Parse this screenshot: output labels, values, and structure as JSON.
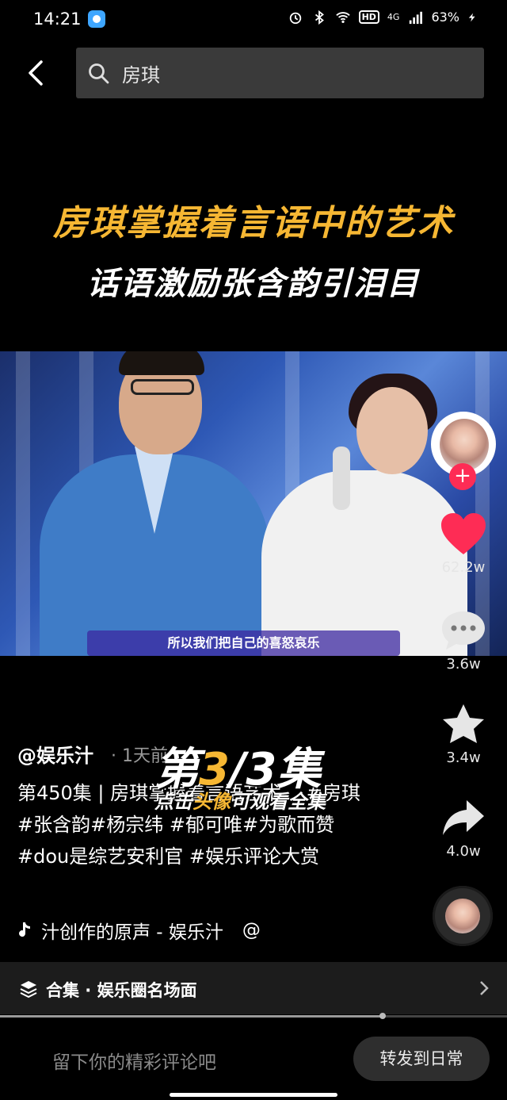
{
  "status_bar": {
    "time": "14:21",
    "battery": "63%",
    "net": "4G",
    "hd": "HD"
  },
  "search": {
    "query": "房琪"
  },
  "video": {
    "headline1": "房琪掌握着言语中的艺术",
    "headline2": "话语激励张含韵引泪目",
    "subtitle": "所以我们把自己的喜怒哀乐"
  },
  "actions": {
    "likes": "62.2w",
    "comments": "3.6w",
    "favorites": "3.4w",
    "shares": "4.0w"
  },
  "post": {
    "author": "@娱乐汁",
    "age": "· 1天前",
    "description": "第450集 | 房琪掌握着言语艺术， #房琪#张含韵#杨宗纬 #郁可唯#为歌而赞 #dou是综艺安利官 #娱乐评论大赏",
    "episode_big_prefix": "第",
    "episode_num": "3",
    "episode_big_suffix": "/3集",
    "episode_small_prefix": "点击",
    "episode_small_hl": "头像",
    "episode_small_suffix": "可观看全集",
    "music": "汁创作的原声 - 娱乐汁",
    "music_at": "@"
  },
  "collection": {
    "label": "合集 · 娱乐圈名场面"
  },
  "playback": {
    "progress": 0.755
  },
  "comment": {
    "placeholder": "留下你的精彩评论吧",
    "repost": "转发到日常"
  },
  "colors": {
    "accent": "#f6b733",
    "like": "#fe2c55"
  }
}
